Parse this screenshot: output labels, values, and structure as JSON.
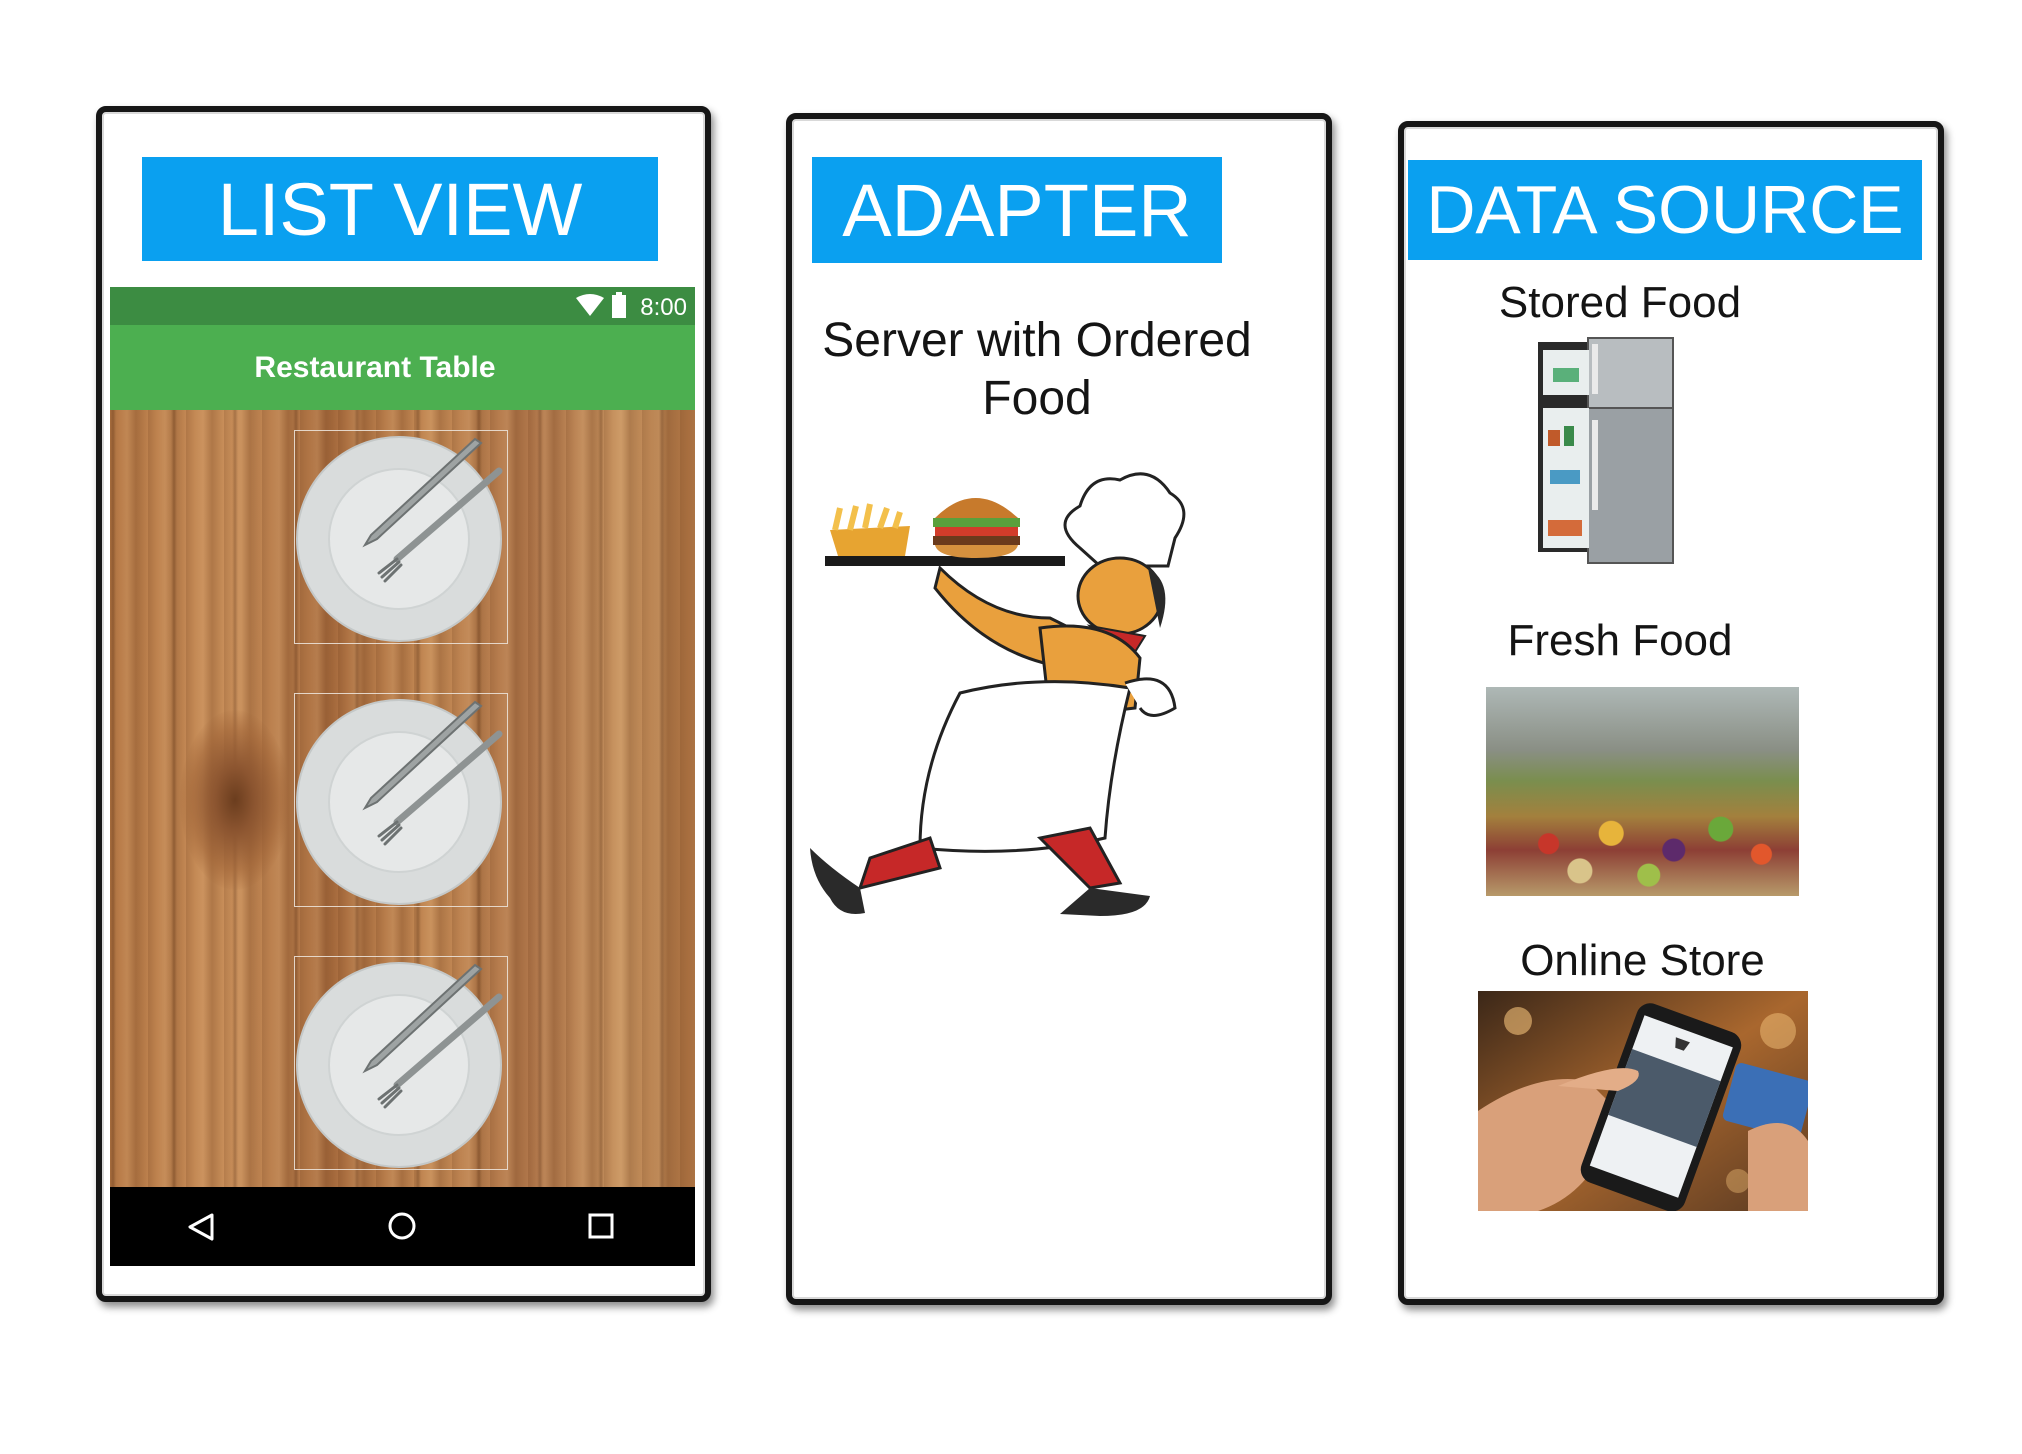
{
  "panels": [
    {
      "heading": "LIST VIEW",
      "phone": {
        "status_time": "8:00",
        "app_title": "Restaurant Table",
        "list_items": [
          "plate",
          "plate",
          "plate"
        ],
        "nav_buttons": [
          "back",
          "home",
          "recents"
        ]
      }
    },
    {
      "heading": "ADAPTER",
      "caption": "Server with Ordered Food"
    },
    {
      "heading": "DATA SOURCE",
      "sources": [
        {
          "label": "Stored Food",
          "image": "refrigerator"
        },
        {
          "label": "Fresh Food",
          "image": "market-produce-stalls"
        },
        {
          "label": "Online Store",
          "image": "hand-holding-smartphone-shopping"
        }
      ]
    }
  ],
  "colors": {
    "heading_bg": "#0aa0f0",
    "status_bar": "#3c8c42",
    "app_bar": "#4caf50",
    "nav_bar": "#000000"
  }
}
